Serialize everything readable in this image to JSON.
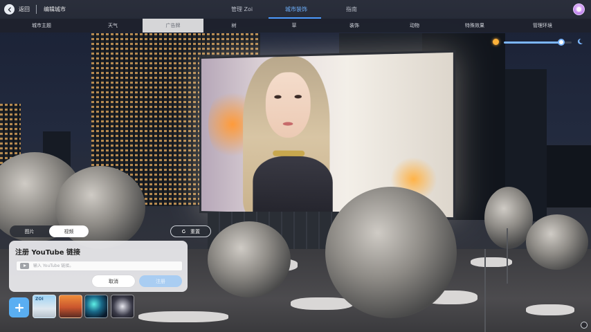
{
  "header": {
    "back_label": "返回",
    "page_title": "编辑城市",
    "tabs": [
      {
        "label": "管理 Zoi"
      },
      {
        "label": "城市装饰"
      },
      {
        "label": "指南"
      }
    ],
    "active_tab": "城市装饰"
  },
  "categories": {
    "items": [
      {
        "label": "城市主题"
      },
      {
        "label": "天气"
      },
      {
        "label": "广告牌"
      },
      {
        "label": "树"
      },
      {
        "label": "草"
      },
      {
        "label": "装饰"
      },
      {
        "label": "动物"
      },
      {
        "label": "特殊效果"
      },
      {
        "label": "管理环境"
      }
    ],
    "active": "广告牌"
  },
  "time_slider": {
    "value": 0.85,
    "start_icon": "sun-icon",
    "end_icon": "moon-icon",
    "accent": "#7cb6ff"
  },
  "media_panel": {
    "segment": {
      "image_label": "图片",
      "video_label": "视频",
      "active": "视频"
    },
    "reset_label": "重置",
    "youtube": {
      "title": "注册 YouTube 链接",
      "input_placeholder": "输入 YouTube 链接。",
      "input_value": "",
      "cancel_label": "取消",
      "submit_label": "注册"
    },
    "thumbnails": [
      {
        "label": "ZOI",
        "name": "zoi-thumbnail"
      },
      {
        "label": "",
        "name": "sunset-thumbnail"
      },
      {
        "label": "",
        "name": "aurora-thumbnail"
      },
      {
        "label": "",
        "name": "moon-thumbnail"
      }
    ]
  },
  "colors": {
    "accent_blue": "#4c9bff",
    "add_button": "#5aaef2",
    "submit_disabled": "#a9cdf2"
  }
}
